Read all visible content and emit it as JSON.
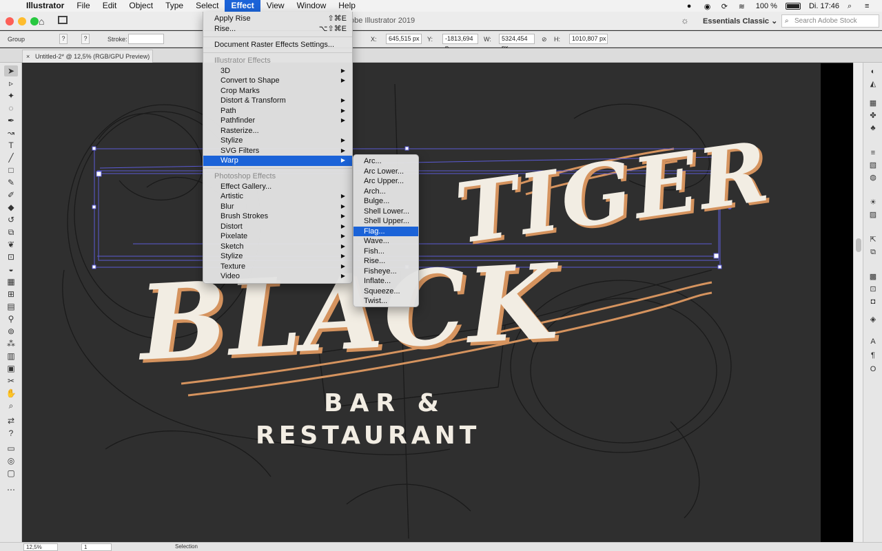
{
  "menubar": {
    "app_name": "Illustrator",
    "items": [
      "File",
      "Edit",
      "Object",
      "Type",
      "Select",
      "Effect",
      "View",
      "Window",
      "Help"
    ],
    "active": "Effect",
    "battery": "100 %",
    "clock": "Di. 17:46"
  },
  "appbar": {
    "doc_title": "obe Illustrator 2019",
    "workspace": "Essentials Classic",
    "search_placeholder": "Search Adobe Stock"
  },
  "controlbar": {
    "selection_label": "Group",
    "stroke_label": "Stroke:",
    "x_label": "X:",
    "x_value": "645,515 px",
    "y_label": "Y:",
    "y_value": "-1813,694 p",
    "w_label": "W:",
    "w_value": "5324,454 px",
    "h_label": "H:",
    "h_value": "1010,807 px"
  },
  "tab": {
    "title": "Untitled-2* @ 12,5% (RGB/GPU Preview)"
  },
  "artwork": {
    "word1": "BLACK",
    "word2": "TIGER",
    "line1": "BAR &",
    "line2": "RESTAURANT"
  },
  "status": {
    "zoom": "12,5%",
    "artboard": "1",
    "tool": "Selection"
  },
  "effect_menu": {
    "apply_rise": "Apply Rise",
    "apply_rise_shortcut": "⇧⌘E",
    "rise": "Rise...",
    "rise_shortcut": "⌥⇧⌘E",
    "doc_raster": "Document Raster Effects Settings...",
    "illustrator_header": "Illustrator Effects",
    "illustrator_items": [
      "3D",
      "Convert to Shape",
      "Crop Marks",
      "Distort & Transform",
      "Path",
      "Pathfinder",
      "Rasterize...",
      "Stylize",
      "SVG Filters",
      "Warp"
    ],
    "photoshop_header": "Photoshop Effects",
    "photoshop_items": [
      "Effect Gallery...",
      "Artistic",
      "Blur",
      "Brush Strokes",
      "Distort",
      "Pixelate",
      "Sketch",
      "Stylize",
      "Texture",
      "Video"
    ],
    "highlighted": "Warp"
  },
  "warp_menu": {
    "items": [
      "Arc...",
      "Arc Lower...",
      "Arc Upper...",
      "Arch...",
      "Bulge...",
      "Shell Lower...",
      "Shell Upper...",
      "Flag...",
      "Wave...",
      "Fish...",
      "Rise...",
      "Fisheye...",
      "Inflate...",
      "Squeeze...",
      "Twist..."
    ],
    "highlighted": "Flag..."
  },
  "colors": {
    "accent": "#1b63d8",
    "canvas": "#2f2f2f",
    "art_cream": "#f2ede3",
    "art_copper": "#d5935e",
    "selection_blue": "#5b5bd6"
  }
}
